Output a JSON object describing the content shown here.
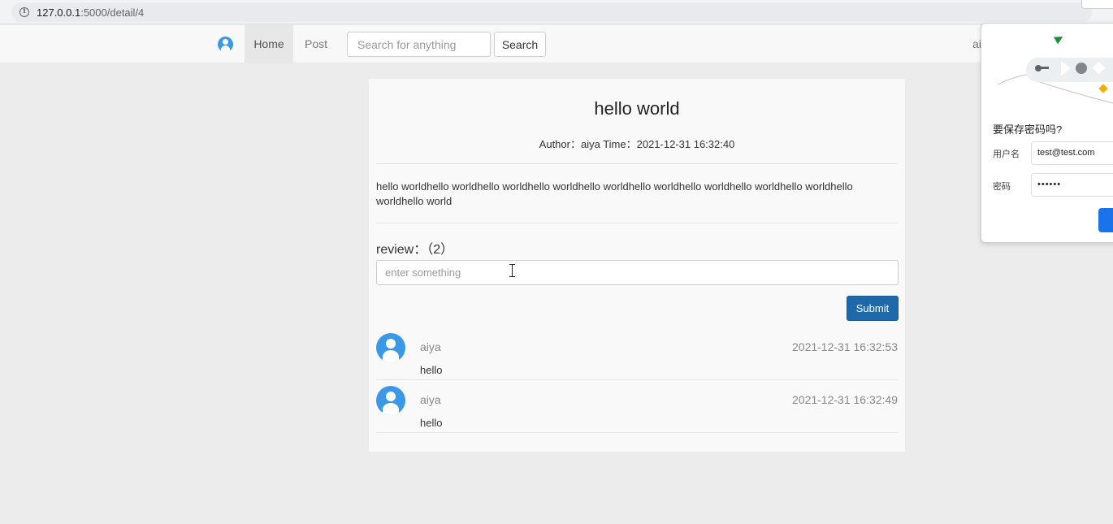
{
  "browser": {
    "url_host": "127.0.0.1",
    "url_path": ":5000/detail/4"
  },
  "navbar": {
    "home_label": "Home",
    "post_label": "Post",
    "search_placeholder": "Search for anything",
    "search_button": "Search",
    "user_label": "ai"
  },
  "post": {
    "title": "hello world",
    "meta": "Author：aiya Time：2021-12-31 16:32:40",
    "content": "hello worldhello worldhello worldhello worldhello worldhello worldhello worldhello worldhello worldhello worldhello world"
  },
  "review": {
    "heading": "review：（2）",
    "input_placeholder": "enter something",
    "submit_label": "Submit",
    "comments": [
      {
        "user": "aiya",
        "time": "2021-12-31 16:32:53",
        "text": "hello"
      },
      {
        "user": "aiya",
        "time": "2021-12-31 16:32:49",
        "text": "hello"
      }
    ]
  },
  "password_popup": {
    "title": "要保存密码吗?",
    "username_label": "用户名",
    "username_value": "test@test.com",
    "password_label": "密码",
    "password_value": "••••••"
  },
  "colors": {
    "accent": "#3b98e6",
    "submit": "#1f68a9",
    "popup_button": "#1a73e8"
  }
}
